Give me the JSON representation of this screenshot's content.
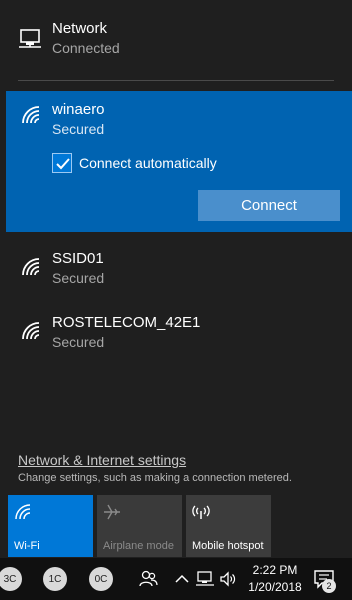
{
  "wired": {
    "title": "Network",
    "status": "Connected"
  },
  "selected_network": {
    "ssid": "winaero",
    "security": "Secured",
    "auto_connect_label": "Connect automatically",
    "auto_connect_checked": true,
    "connect_label": "Connect"
  },
  "networks": [
    {
      "ssid": "SSID01",
      "security": "Secured"
    },
    {
      "ssid": "ROSTELECOM_42E1",
      "security": "Secured"
    }
  ],
  "settings": {
    "link": "Network & Internet settings",
    "description": "Change settings, such as making a connection metered."
  },
  "tiles": [
    {
      "label": "Wi-Fi",
      "icon": "wifi-icon",
      "state": "on"
    },
    {
      "label": "Airplane mode",
      "icon": "airplane-icon",
      "state": "disabled"
    },
    {
      "label": "Mobile hotspot",
      "icon": "hotspot-icon",
      "state": "off"
    }
  ],
  "taskbar": {
    "badges": [
      "3C",
      "1C",
      "0C"
    ],
    "time": "2:22 PM",
    "date": "1/20/2018",
    "notification_count": "2"
  },
  "colors": {
    "accent": "#0063b1",
    "tile_active": "#0078d7",
    "background": "#1f1f1f",
    "taskbar": "#101010"
  }
}
